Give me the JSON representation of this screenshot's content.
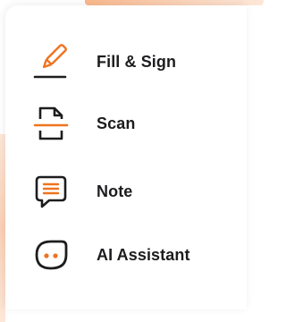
{
  "menu": {
    "items": [
      {
        "label": "Fill & Sign",
        "icon": "pen-sign-icon"
      },
      {
        "label": "Scan",
        "icon": "scan-document-icon"
      },
      {
        "label": "Note",
        "icon": "note-bubble-icon"
      },
      {
        "label": "AI Assistant",
        "icon": "ai-assistant-icon"
      }
    ]
  },
  "colors": {
    "accent": "#f0731f",
    "text": "#1d1d1f"
  }
}
